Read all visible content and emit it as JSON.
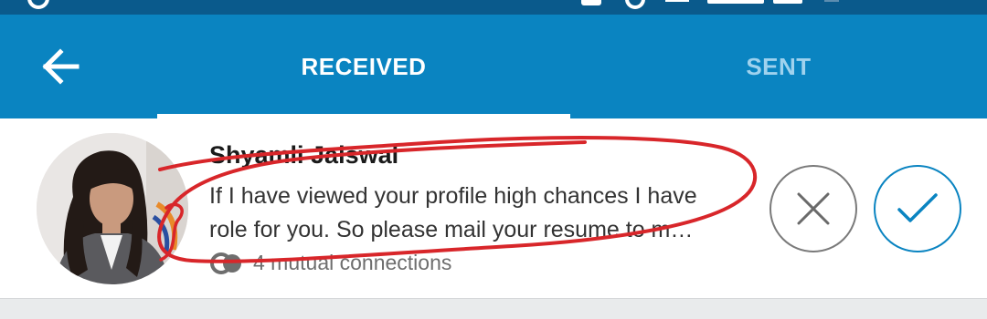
{
  "header": {
    "tabs": [
      {
        "label": "RECEIVED",
        "selected": true
      },
      {
        "label": "SENT",
        "selected": false
      }
    ]
  },
  "invitation": {
    "name": "Shyamli Jaiswal",
    "message_line1": "If I have viewed your profile high chances I have",
    "message_line2": "role for you. So please mail your resume to m…",
    "mutual_connections": "4 mutual connections"
  },
  "colors": {
    "statusbar": "#0a5a8c",
    "appbar": "#0a84c1",
    "tab_selected": "#ffffff",
    "tab_unselected": "#9fd2ee",
    "accept_accent": "#0a84c1",
    "decline_gray": "#7a7a7a",
    "annotation_red": "#d8262a"
  },
  "icons": {
    "back": "arrow-left-icon",
    "decline": "close-icon",
    "accept": "checkmark-icon",
    "mutual": "mutual-connections-icon"
  }
}
